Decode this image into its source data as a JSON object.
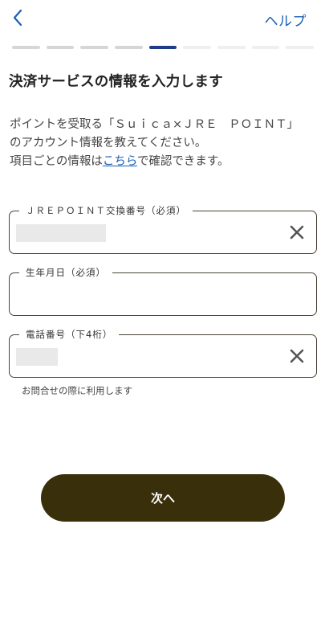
{
  "header": {
    "help_label": "ヘルプ",
    "back_icon": "chevron-left-icon"
  },
  "progress": {
    "total_steps": 9,
    "current_step": 5
  },
  "main": {
    "title": "決済サービスの情報を入力します",
    "description_line1": "ポイントを受取る「Ｓｕｉｃａ×ＪＲＥ　ＰＯＩＮＴ」",
    "description_line2": "のアカウント情報を教えてください。",
    "description_line3_pre": "項目ごとの情報は",
    "description_link": "こちら",
    "description_line3_post": "で確認できます。"
  },
  "form": {
    "jre_label": "ＪＲＥＰＯＩＮＴ交換番号（必須）",
    "birth_label": "生年月日（必須）",
    "phone_label": "電話番号（下4桁）",
    "phone_hint": "お問合せの際に利用します",
    "clear_icon": "close-icon"
  },
  "footer": {
    "next_label": "次へ"
  },
  "colors": {
    "accent": "#1a5fb4",
    "progress_active": "#1f3c88",
    "button": "#3a2f0b"
  }
}
